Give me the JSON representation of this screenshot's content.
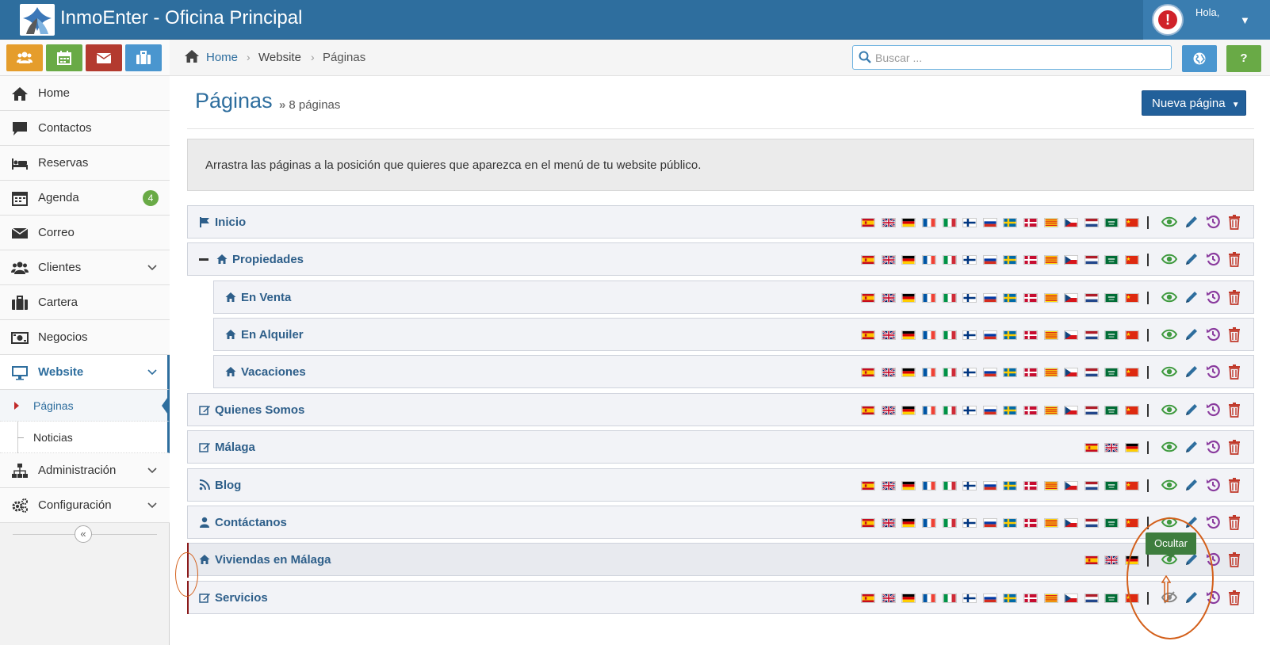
{
  "header": {
    "app_title": "InmoEnter - Oficina Principal",
    "greeting": "Hola,"
  },
  "colors": {
    "header": "#2e6e9e",
    "orange": "#e59d2c",
    "green": "#69aa46",
    "red": "#b33a2f",
    "blue": "#4a96cf",
    "label_blue": "#2e5f8a"
  },
  "shortcuts": [
    "users-icon",
    "calendar-icon",
    "envelope-icon",
    "briefcase-icon"
  ],
  "nav": {
    "home": "Home",
    "contactos": "Contactos",
    "reservas": "Reservas",
    "agenda": "Agenda",
    "agenda_badge": "4",
    "correo": "Correo",
    "clientes": "Clientes",
    "cartera": "Cartera",
    "negocios": "Negocios",
    "website": "Website",
    "paginas": "Páginas",
    "noticias": "Noticias",
    "administracion": "Administración",
    "configuracion": "Configuración"
  },
  "breadcrumb": {
    "home": "Home",
    "website": "Website",
    "paginas": "Páginas"
  },
  "search": {
    "placeholder": "Buscar ..."
  },
  "page": {
    "title": "Páginas",
    "subtitle": "8 páginas",
    "new_button": "Nueva página",
    "info": "Arrastra las páginas a la posición que quieres que aparezca en el menú de tu website público."
  },
  "flag_sets": {
    "full": [
      "es",
      "gb",
      "de",
      "fr",
      "it",
      "fi",
      "ru",
      "se",
      "dk",
      "ca",
      "cz",
      "nl",
      "sa",
      "cn"
    ],
    "short": [
      "es",
      "gb",
      "de"
    ]
  },
  "pages": [
    {
      "label": "Inicio",
      "icon": "flag-icon",
      "flags": "full",
      "visible": true
    },
    {
      "label": "Propiedades",
      "icon": "home-icon",
      "flags": "full",
      "visible": true,
      "expanded": true
    },
    {
      "label": "En Venta",
      "icon": "home-icon",
      "flags": "full",
      "visible": true,
      "child": true
    },
    {
      "label": "En Alquiler",
      "icon": "home-icon",
      "flags": "full",
      "visible": true,
      "child": true
    },
    {
      "label": "Vacaciones",
      "icon": "home-icon",
      "flags": "full",
      "visible": true,
      "child": true
    },
    {
      "label": "Quienes Somos",
      "icon": "edit-icon",
      "flags": "full",
      "visible": true
    },
    {
      "label": "Málaga",
      "icon": "edit-icon",
      "flags": "short",
      "visible": true
    },
    {
      "label": "Blog",
      "icon": "rss-icon",
      "flags": "full",
      "visible": true
    },
    {
      "label": "Contáctanos",
      "icon": "user-icon",
      "flags": "full",
      "visible": true
    },
    {
      "label": "Viviendas en Málaga",
      "icon": "home-icon",
      "flags": "short",
      "visible": true,
      "highlighted": true
    },
    {
      "label": "Servicios",
      "icon": "edit-icon",
      "flags": "full",
      "visible": false
    }
  ],
  "tooltip": "Ocultar"
}
